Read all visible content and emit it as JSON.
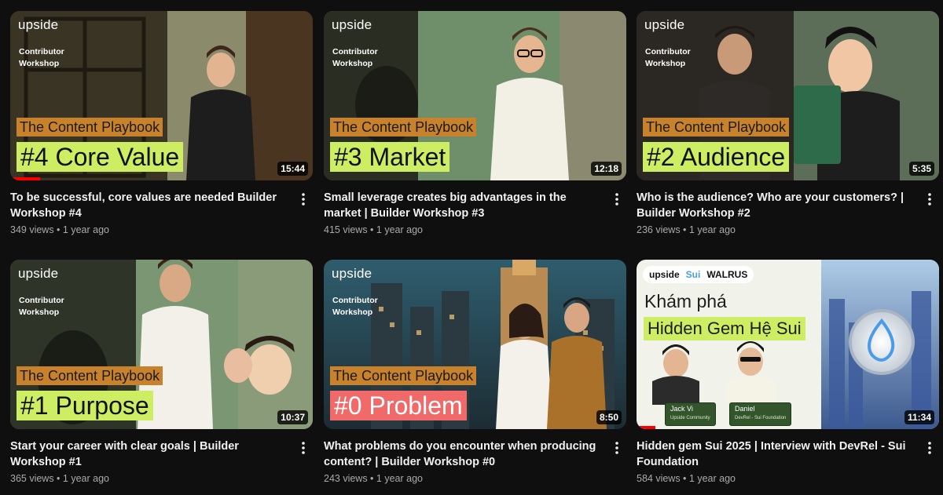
{
  "videos": [
    {
      "brand": "upside",
      "subtitle": "Contributor Workshop",
      "playbook": "The Content Playbook",
      "topic": "#4 Core Value",
      "duration": "15:44",
      "progress": 0.1,
      "title": "To be successful, core values are needed Builder Workshop #4",
      "stats": "349 views • 1 year ago"
    },
    {
      "brand": "upside",
      "subtitle": "Contributor Workshop",
      "playbook": "The Content Playbook",
      "topic": "#3 Market",
      "duration": "12:18",
      "title": "Small leverage creates big advantages in the market | Builder Workshop #3",
      "stats": "415 views • 1 year ago"
    },
    {
      "brand": "upside",
      "subtitle": "Contributor Workshop",
      "playbook": "The Content Playbook",
      "topic": "#2 Audience",
      "duration": "5:35",
      "title": "Who is the audience? Who are your customers? | Builder Workshop #2",
      "stats": "236 views • 1 year ago"
    },
    {
      "brand": "upside",
      "subtitle": "Contributor Workshop",
      "playbook": "The Content Playbook",
      "topic": "#1 Purpose",
      "duration": "10:37",
      "title": "Start your career with clear goals | Builder Workshop #1",
      "stats": "365 views • 1 year ago"
    },
    {
      "brand": "upside",
      "subtitle": "Contributor Workshop",
      "playbook": "The Content Playbook",
      "topic": "#0  Problem",
      "duration": "8:50",
      "title": "What problems do you encounter when producing content? | Builder Workshop #0",
      "stats": "243 views • 1 year ago"
    },
    {
      "logos": [
        "upside",
        "Sui",
        "WALRUS"
      ],
      "headline": "Khám phá",
      "highlight": "Hidden Gem Hệ Sui",
      "guests": [
        {
          "name": "Jack Vi",
          "role": "Upside Community"
        },
        {
          "name": "Daniel",
          "role": "DevRel - Sui Foundation"
        }
      ],
      "duration": "11:34",
      "progress": 0.06,
      "title": "Hidden gem Sui 2025 | Interview with DevRel - Sui Foundation",
      "stats": "584 views • 1 year ago"
    }
  ],
  "colors": {
    "background": "#0f0f0f",
    "topic_highlight": "#cdee63",
    "topic_red": "#f06a6a",
    "playbook_bar": "#c9822c",
    "progress": "#ff0000"
  },
  "icons": {
    "menu": "more-vert-icon"
  }
}
